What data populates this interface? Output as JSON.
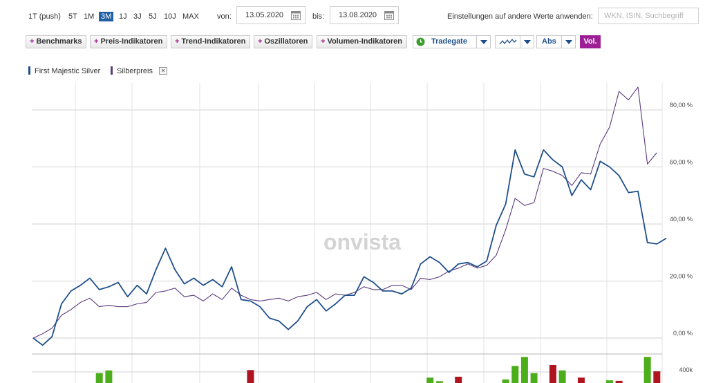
{
  "ranges": [
    "1T (push)",
    "5T",
    "1M",
    "3M",
    "1J",
    "3J",
    "5J",
    "10J",
    "MAX"
  ],
  "active_range": "3M",
  "from_label": "von:",
  "from_date": "13.05.2020",
  "to_label": "bis:",
  "to_date": "13.08.2020",
  "apply_label": "Einstellungen auf andere Werte anwenden:",
  "search_placeholder": "WKN, ISIN, Suchbegriff",
  "toolbar": {
    "benchmarks": "Benchmarks",
    "price_indicators": "Preis-Indikatoren",
    "trend_indicators": "Trend-Indikatoren",
    "oscillators": "Oszillatoren",
    "volume_indicators": "Volumen-Indikatoren",
    "exchange": "Tradegate",
    "scale": "Abs",
    "volume": "Vol."
  },
  "watermark": "onvista",
  "colors": {
    "series1": "#1f4f8a",
    "series2": "#5a3a7e",
    "vol_up": "#4cae1a",
    "vol_down": "#b0141e",
    "accent": "#9c1f95"
  },
  "chart_data": {
    "type": "line",
    "ylim": [
      -3,
      90
    ],
    "y_ticks": [
      0,
      20,
      40,
      60,
      80
    ],
    "y_tick_labels": [
      "0,00 %",
      "20,00 %",
      "40,00 %",
      "60,00 %",
      "80,00 %"
    ],
    "grid": true,
    "legend_position": "top-left",
    "series": [
      {
        "name": "First Majestic Silver",
        "values": [
          0,
          -2.5,
          0.5,
          12,
          16.5,
          18.5,
          21,
          17,
          18,
          19.5,
          14.5,
          18.5,
          15.5,
          24,
          31.5,
          24,
          19,
          21,
          18.5,
          20.5,
          18,
          25,
          13.5,
          13,
          11,
          7,
          6,
          3,
          6,
          11,
          13.5,
          9.5,
          12,
          15,
          15,
          21.5,
          19.5,
          16.5,
          16.5,
          15.5,
          17.5,
          26,
          28.5,
          26.5,
          23,
          26,
          26.5,
          25,
          27,
          39.5,
          47,
          66,
          57.5,
          56.5,
          66,
          62.5,
          60,
          50,
          55.5,
          52,
          62,
          60,
          57,
          51,
          51.5,
          33.5,
          33,
          35
        ]
      },
      {
        "name": "Silberpreis",
        "values": [
          0,
          1.5,
          3.5,
          8,
          10,
          12.5,
          14,
          11,
          11.5,
          11,
          11,
          12,
          12.5,
          16,
          16.5,
          17.5,
          14.5,
          15,
          13,
          15.5,
          13.5,
          17.5,
          15,
          13.5,
          13,
          13.5,
          14,
          13,
          14.5,
          15,
          16,
          13.5,
          15.5,
          15,
          16,
          18,
          17,
          17,
          18.5,
          18.5,
          17,
          21,
          20.5,
          21.5,
          23.5,
          24.5,
          26,
          24.5,
          25.5,
          29,
          38,
          49,
          46.5,
          47.5,
          59.5,
          58.5,
          57,
          53.5,
          58,
          57.5,
          68,
          74,
          86.5,
          83.5,
          88,
          61,
          65
        ]
      }
    ],
    "volume": {
      "scale_label": "400k",
      "bars": [
        {
          "x": 7,
          "up": true,
          "size": 0.55
        },
        {
          "x": 8,
          "up": true,
          "size": 0.7
        },
        {
          "x": 23,
          "up": false,
          "size": 0.72
        },
        {
          "x": 42,
          "up": true,
          "size": 0.3
        },
        {
          "x": 43,
          "up": true,
          "size": 0.1
        },
        {
          "x": 45,
          "up": false,
          "size": 0.35
        },
        {
          "x": 50,
          "up": true,
          "size": 0.2
        },
        {
          "x": 51,
          "up": true,
          "size": 0.95
        },
        {
          "x": 52,
          "up": true,
          "size": 1.45
        },
        {
          "x": 53,
          "up": true,
          "size": 0.55
        },
        {
          "x": 55,
          "up": false,
          "size": 1.0
        },
        {
          "x": 56,
          "up": true,
          "size": 0.7
        },
        {
          "x": 58,
          "up": false,
          "size": 0.3
        },
        {
          "x": 61,
          "up": true,
          "size": 0.15
        },
        {
          "x": 62,
          "up": false,
          "size": 0.12
        },
        {
          "x": 65,
          "up": true,
          "size": 1.45
        },
        {
          "x": 66,
          "up": false,
          "size": 0.65
        }
      ]
    }
  }
}
